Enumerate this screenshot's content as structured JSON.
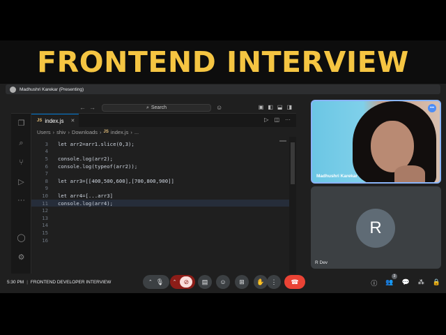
{
  "banner": {
    "title": "FRONTEND INTERVIEW"
  },
  "presenter": {
    "name": "Madhushri Karekar (Presenting)"
  },
  "editor": {
    "search_label": "Search",
    "tab_label": "index.js",
    "tab_icon_label": "JS",
    "breadcrumb": [
      "Users",
      "shiv",
      "Downloads",
      "index.js",
      "..."
    ],
    "lines": [
      {
        "n": "3",
        "text": "let arr2=arr1.slice(0,3);"
      },
      {
        "n": "4",
        "text": ""
      },
      {
        "n": "5",
        "text": "console.log(arr2);"
      },
      {
        "n": "6",
        "text": "console.log(typeof(arr2));"
      },
      {
        "n": "7",
        "text": ""
      },
      {
        "n": "8",
        "text": "let arr3=[[400,500,600],[700,800,900]]"
      },
      {
        "n": "9",
        "text": ""
      },
      {
        "n": "10",
        "text": "let arr4=[...arr3]"
      },
      {
        "n": "11",
        "text": "console.log(arr4);"
      },
      {
        "n": "12",
        "text": ""
      },
      {
        "n": "13",
        "text": ""
      },
      {
        "n": "14",
        "text": ""
      },
      {
        "n": "15",
        "text": ""
      },
      {
        "n": "16",
        "text": ""
      }
    ],
    "current_line": "11"
  },
  "participants": {
    "camera": {
      "name": "Madhushri Karekar"
    },
    "rdev": {
      "initial": "R",
      "name": "R Dev"
    }
  },
  "controls": {
    "time": "5:30 PM",
    "separator": "|",
    "meeting_title": "FRONTEND DEVELOPER INTERVIEW",
    "people_count": "3"
  }
}
